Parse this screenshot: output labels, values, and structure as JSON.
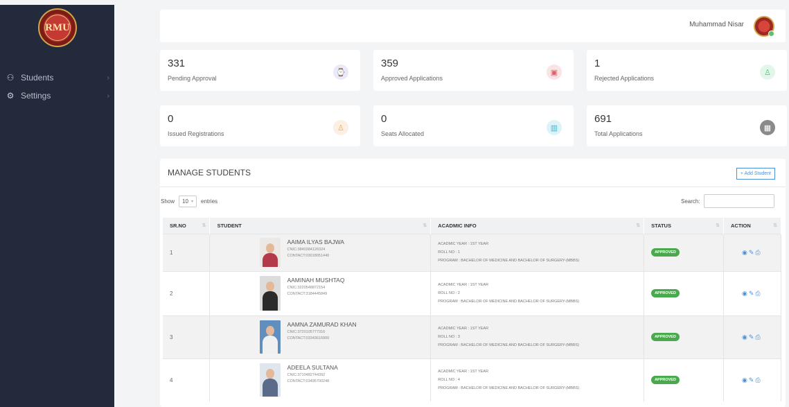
{
  "sidebar": {
    "logo_text": "RMU",
    "items": [
      {
        "label": "Students",
        "icon": "users-icon"
      },
      {
        "label": "Settings",
        "icon": "gear-icon"
      }
    ]
  },
  "header": {
    "user_name": "Muhammad Nisar"
  },
  "stats": [
    {
      "value": "331",
      "label": "Pending Approval",
      "icon": "watch-icon",
      "color": "#8b84d7",
      "bg": "#ebe9f8"
    },
    {
      "value": "359",
      "label": "Approved Applications",
      "icon": "bag-icon",
      "color": "#e0606a",
      "bg": "#fbe4e5"
    },
    {
      "value": "1",
      "label": "Rejected Applications",
      "icon": "user-plus-icon",
      "color": "#4cc17c",
      "bg": "#e2f6ea"
    },
    {
      "value": "0",
      "label": "Issued Registrations",
      "icon": "user-plus-icon",
      "color": "#f0a85a",
      "bg": "#fdefe1"
    },
    {
      "value": "0",
      "label": "Seats Allocated",
      "icon": "map-icon",
      "color": "#3bb8d6",
      "bg": "#ddf3f9"
    },
    {
      "value": "691",
      "label": "Total Applications",
      "icon": "grid-icon",
      "color": "#ffffff",
      "bg": "#8a8a8a"
    }
  ],
  "manage": {
    "title": "MANAGE STUDENTS",
    "add_label": "+ Add Student",
    "show_label": "Show",
    "entries_value": "10",
    "entries_label": "entries",
    "search_label": "Search:",
    "columns": [
      "SR.NO",
      "STUDENT",
      "ACADMIC INFO",
      "STATUS",
      "ACTION"
    ],
    "rows": [
      {
        "sr": "1",
        "name": "AAIMA ILYAS BAJWA",
        "cnic": "CNIC:3840384126324",
        "contact": "CONTACT:03018051440",
        "year": "ACADMIC YEAR : 1ST YEAR",
        "roll": "ROLL NO : 1",
        "program": "PROGRAM : BACHELOR OF MEDICINE AND BACHELOR OF SURGERY-(MBBS)",
        "status": "APPROVED",
        "photo_color": "#b43a4a"
      },
      {
        "sr": "2",
        "name": "AAMINAH MUSHTAQ",
        "cnic": "CNIC:3220548872154",
        "contact": "CONTACT:3184445849",
        "year": "ACADMIC YEAR : 1ST YEAR",
        "roll": "ROLL NO : 2",
        "program": "PROGRAM : BACHELOR OF MEDICINE AND BACHELOR OF SURGERY-(MBBS)",
        "status": "APPROVED",
        "photo_color": "#2a2a2a"
      },
      {
        "sr": "3",
        "name": "AAMNA ZAMURAD KHAN",
        "cnic": "CNIC:3720105777316",
        "contact": "CONTACT:03343616900",
        "year": "ACADMIC YEAR : 1ST YEAR",
        "roll": "ROLL NO : 3",
        "program": "PROGRAM : BACHELOR OF MEDICINE AND BACHELOR OF SURGERY-(MBBS)",
        "status": "APPROVED",
        "photo_color": "#e9ecef"
      },
      {
        "sr": "4",
        "name": "ADEELA SULTANA",
        "cnic": "CNIC:3710482744392",
        "contact": "CONTACT:03495700248",
        "year": "ACADMIC YEAR : 1ST YEAR",
        "roll": "ROLL NO : 4",
        "program": "PROGRAM : BACHELOR OF MEDICINE AND BACHELOR OF SURGERY-(MBBS)",
        "status": "APPROVED",
        "photo_color": "#5a6c8a"
      }
    ],
    "action_icons": [
      "eye-icon",
      "edit-icon",
      "print-icon"
    ]
  }
}
